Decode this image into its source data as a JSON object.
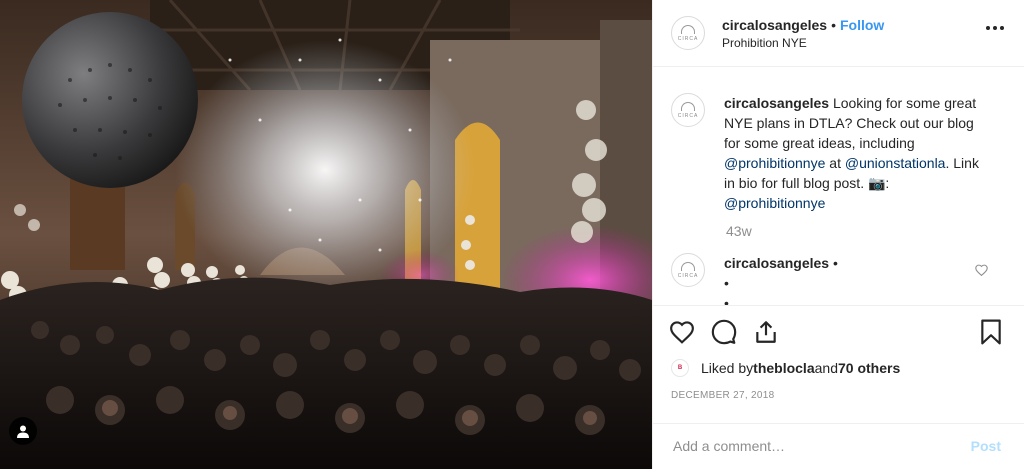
{
  "post": {
    "username": "circalosangeles",
    "follow_label": "Follow",
    "location": "Prohibition NYE",
    "avatar_text": "CIRCA",
    "caption": {
      "username": "circalosangeles",
      "text_1": " Looking for some great NYE plans in DTLA? Check out our blog for some great ideas, including ",
      "mention_1": "@prohibitionnye",
      "text_2": " at ",
      "mention_2": "@unionstationla",
      "text_3": ". Link in bio for full blog post. 📷: ",
      "mention_3": "@prohibitionnye"
    },
    "age": "43w",
    "comment": {
      "username": "circalosangeles",
      "bullet": "•",
      "line2": "•",
      "line3": "•"
    },
    "likes": {
      "prefix": "Liked by ",
      "liker": "theblocla",
      "and": " and ",
      "others": "70 others"
    },
    "date": "DECEMBER 27, 2018",
    "add_comment_placeholder": "Add a comment…",
    "post_label": "Post"
  },
  "colors": {
    "accent": "#3897f0",
    "post_disabled": "#b2dffc",
    "mention": "#003569"
  },
  "icons": {
    "more": "more-options-icon",
    "like": "heart-icon",
    "comment": "comment-icon",
    "share": "share-icon",
    "save": "bookmark-icon",
    "user_tag": "user-tag-icon"
  }
}
